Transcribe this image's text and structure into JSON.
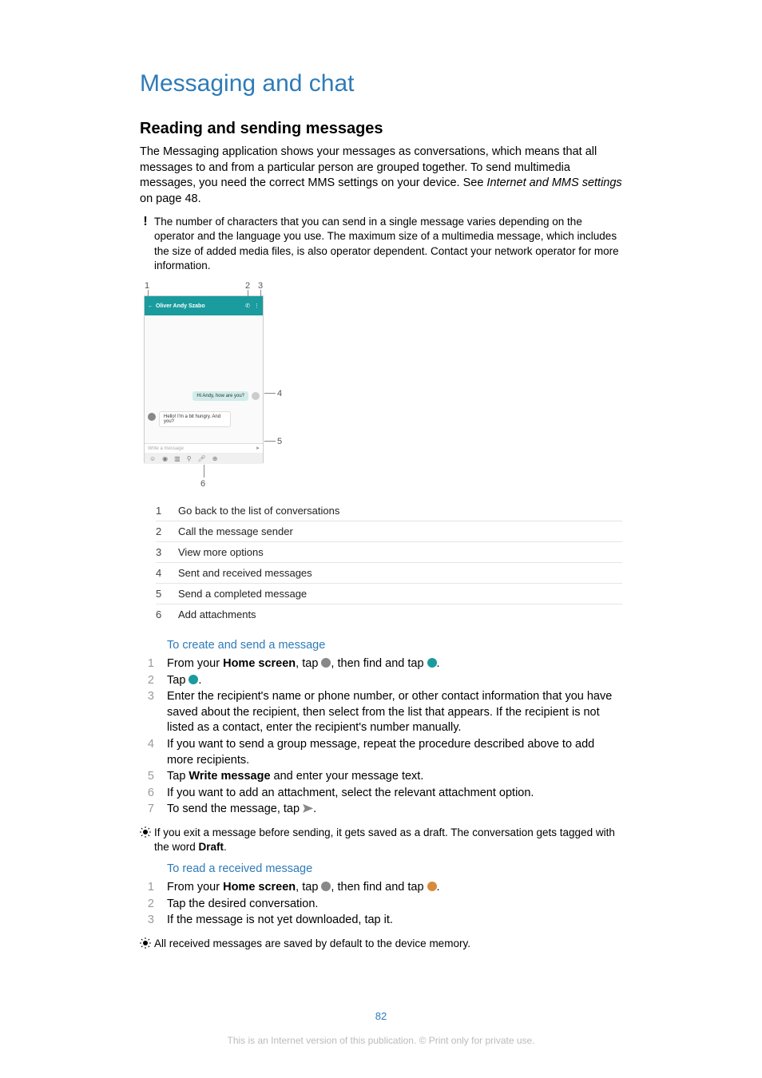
{
  "title": "Messaging and chat",
  "section": "Reading and sending messages",
  "intro_p1": "The Messaging application shows your messages as conversations, which means that all messages to and from a particular person are grouped together. To send multimedia messages, you need the correct MMS settings on your device. See ",
  "intro_link": "Internet and MMS settings",
  "intro_p2": " on page 48.",
  "warning": "The number of characters that you can send in a single message varies depending on the operator and the language you use. The maximum size of a multimedia message, which includes the size of added media files, is also operator dependent. Contact your network operator for more information.",
  "figure": {
    "header_name": "Oliver Andy Szabo",
    "bubble_in": "Hi Andy, how are you?",
    "bubble_out": "Hello! I'm a bit hungry. And you?",
    "input_placeholder": "Write a message",
    "labels": {
      "l1": "1",
      "l2": "2",
      "l3": "3",
      "l4": "4",
      "l5": "5",
      "l6": "6"
    }
  },
  "legend": [
    {
      "n": "1",
      "t": "Go back to the list of conversations"
    },
    {
      "n": "2",
      "t": "Call the message sender"
    },
    {
      "n": "3",
      "t": "View more options"
    },
    {
      "n": "4",
      "t": "Sent and received messages"
    },
    {
      "n": "5",
      "t": "Send a completed message"
    },
    {
      "n": "6",
      "t": "Add attachments"
    }
  ],
  "proc1_heading": "To create and send a message",
  "proc1": {
    "s1a": "From your ",
    "s1b": "Home screen",
    "s1c": ", tap ",
    "s1d": ", then find and tap ",
    "s1e": ".",
    "s2a": "Tap ",
    "s2b": ".",
    "s3": "Enter the recipient's name or phone number, or other contact information that you have saved about the recipient, then select from the list that appears. If the recipient is not listed as a contact, enter the recipient's number manually.",
    "s4": "If you want to send a group message, repeat the procedure described above to add more recipients.",
    "s5a": "Tap ",
    "s5b": "Write message",
    "s5c": " and enter your message text.",
    "s6": "If you want to add an attachment, select the relevant attachment option.",
    "s7a": "To send the message, tap ",
    "s7b": "."
  },
  "tip1a": "If you exit a message before sending, it gets saved as a draft. The conversation gets tagged with the word ",
  "tip1b": "Draft",
  "tip1c": ".",
  "proc2_heading": "To read a received message",
  "proc2": {
    "s1a": "From your ",
    "s1b": "Home screen",
    "s1c": ", tap ",
    "s1d": ", then find and tap ",
    "s1e": ".",
    "s2": "Tap the desired conversation.",
    "s3": "If the message is not yet downloaded, tap it."
  },
  "tip2": "All received messages are saved by default to the device memory.",
  "page_number": "82",
  "footer": "This is an Internet version of this publication. © Print only for private use."
}
